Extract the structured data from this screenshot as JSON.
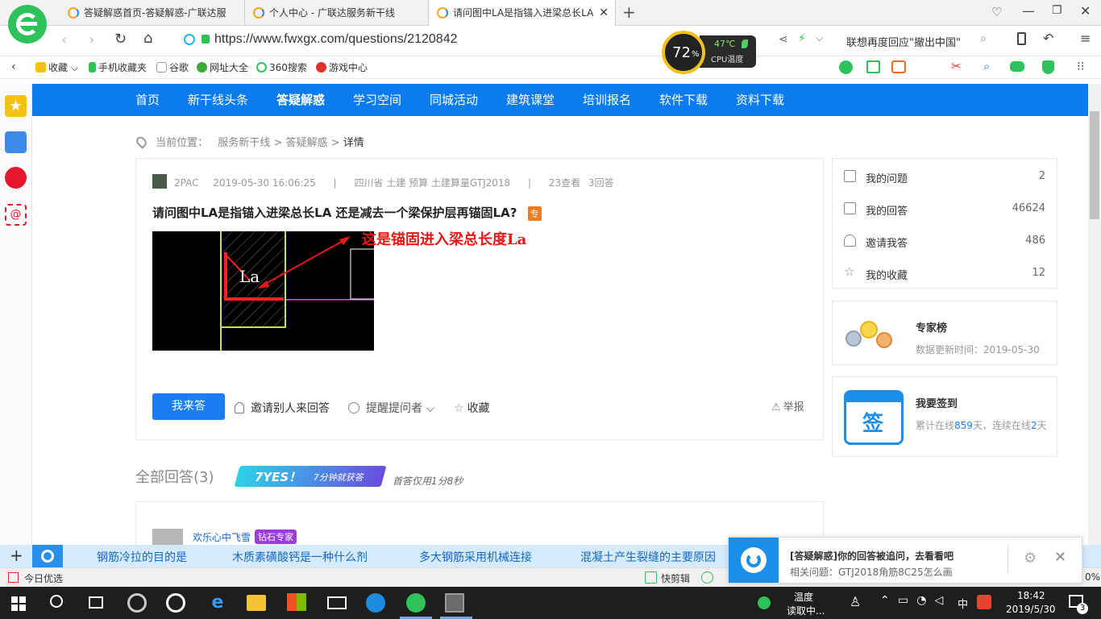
{
  "browser": {
    "tabs": [
      {
        "label": "答疑解惑首页-答疑解惑-广联达服"
      },
      {
        "label": "个人中心 - 广联达服务新干线"
      },
      {
        "label": "请问图中LA是指锚入进梁总长LA"
      }
    ],
    "url": "https://www.fwxgx.com/questions/2120842",
    "cpu": {
      "percent": "72",
      "percent_sign": "%",
      "temp": "47℃",
      "label": "CPU温度"
    },
    "search_text": "联想再度回应\"撤出中国\"",
    "favorites": [
      "收藏",
      "手机收藏夹",
      "谷歌",
      "网址大全",
      "360搜索",
      "游戏中心"
    ]
  },
  "nav": {
    "items": [
      "首页",
      "新干线头条",
      "答疑解惑",
      "学习空间",
      "同城活动",
      "建筑课堂",
      "培训报名",
      "软件下载",
      "资料下载"
    ]
  },
  "breadcrumb": {
    "prefix": "当前位置：",
    "items": [
      "服务新干线",
      ">",
      "答疑解惑",
      ">",
      "详情"
    ]
  },
  "question": {
    "author": "2PAC",
    "time": "2019-05-30 16:06:25",
    "sep": "|",
    "tags": "四川省 土建 预算 土建算量GTJ2018",
    "views": "23查看",
    "answers": "3回答",
    "title": "请问图中LA是指锚入进梁总长LA 还是减去一个梁保护层再锚固LA?",
    "badge": "专",
    "annotation": "这是锚固进入梁总长度La",
    "cad_label": "La"
  },
  "actions": {
    "answer": "我来答",
    "invite": "邀请别人来回答",
    "remind": "提醒提问者",
    "favorite": "收藏",
    "report": "举报"
  },
  "answers_section": {
    "title": "全部回答(3)",
    "banner": "7YES！",
    "banner_sub": "7分钟就获答",
    "first_answer": "首答仅用1分8秒",
    "answerer": "欢乐心中飞雪",
    "answerer_badge": "钻石专家"
  },
  "sidebar": {
    "stats": [
      {
        "label": "我的问题",
        "count": "2"
      },
      {
        "label": "我的回答",
        "count": "46624"
      },
      {
        "label": "邀请我答",
        "count": "486"
      },
      {
        "label": "我的收藏",
        "count": "12"
      }
    ],
    "expert": {
      "title": "专家榜",
      "date": "数据更新时间：2019-05-30"
    },
    "checkin": {
      "title": "我要签到",
      "icon_text": "签",
      "text_a": "累计在线",
      "days": "859",
      "text_b": "天，连续在线",
      "streak": "2",
      "text_c": "天"
    }
  },
  "hotbar": {
    "items": [
      "钢筋冷拉的目的是",
      "木质素磺酸钙是一种什么剂",
      "多大钢筋采用机械连接",
      "混凝土产生裂缝的主要原因"
    ]
  },
  "notification": {
    "title": "[答疑解惑]你的回答被追问，去看看吧",
    "related_prefix": "相关问题：",
    "related": "GTJ2018角筋8C25怎么画"
  },
  "status": {
    "left": "今日优选",
    "clip": "快剪辑",
    "zoom": "0%"
  },
  "taskbar": {
    "weather_a": "温度",
    "weather_b": "读取中...",
    "ime": "中",
    "time": "18:42",
    "date": "2019/5/30",
    "notif_count": "3"
  },
  "colors": {
    "nav": "#0a7cf0",
    "accent": "#1a7ef2",
    "annotation": "#e81818"
  }
}
